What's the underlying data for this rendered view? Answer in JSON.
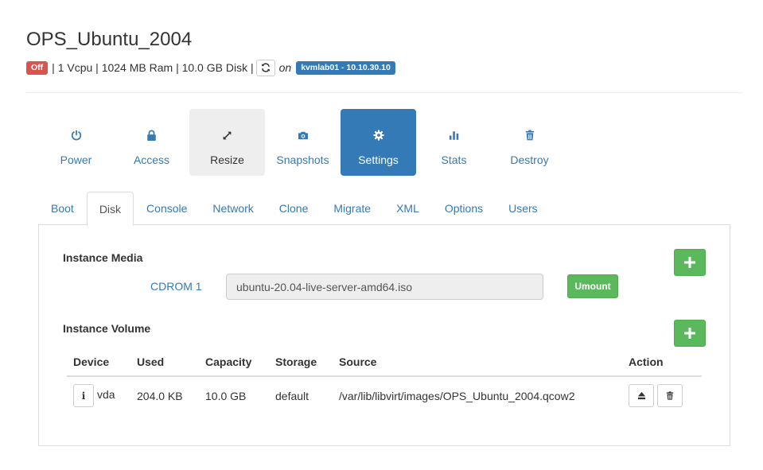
{
  "instance": {
    "title": "OPS_Ubuntu_2004",
    "status": "Off",
    "specs": "| 1 Vcpu | 1024 MB Ram | 10.0 GB Disk |",
    "on_label": "on",
    "host": "kvmlab01 - 10.10.30.10"
  },
  "toolbar": [
    {
      "label": "Power",
      "icon": "power-icon"
    },
    {
      "label": "Access",
      "icon": "lock-icon"
    },
    {
      "label": "Resize",
      "icon": "expand-icon"
    },
    {
      "label": "Snapshots",
      "icon": "camera-icon"
    },
    {
      "label": "Settings",
      "icon": "gear-icon"
    },
    {
      "label": "Stats",
      "icon": "bar-chart-icon"
    },
    {
      "label": "Destroy",
      "icon": "trash-icon"
    }
  ],
  "tabs": [
    "Boot",
    "Disk",
    "Console",
    "Network",
    "Clone",
    "Migrate",
    "XML",
    "Options",
    "Users"
  ],
  "active_tab": "Disk",
  "media": {
    "title": "Instance Media",
    "device_label": "CDROM 1",
    "value": "ubuntu-20.04-live-server-amd64.iso",
    "umount_label": "Umount"
  },
  "volume": {
    "title": "Instance Volume",
    "headers": [
      "Device",
      "Used",
      "Capacity",
      "Storage",
      "Source",
      "Action"
    ],
    "rows": [
      {
        "device": "vda",
        "used": "204.0 KB",
        "capacity": "10.0 GB",
        "storage": "default",
        "source": "/var/lib/libvirt/images/OPS_Ubuntu_2004.qcow2"
      }
    ]
  },
  "colors": {
    "primary": "#337ab7",
    "success": "#5cb85c",
    "danger": "#d9534f"
  }
}
